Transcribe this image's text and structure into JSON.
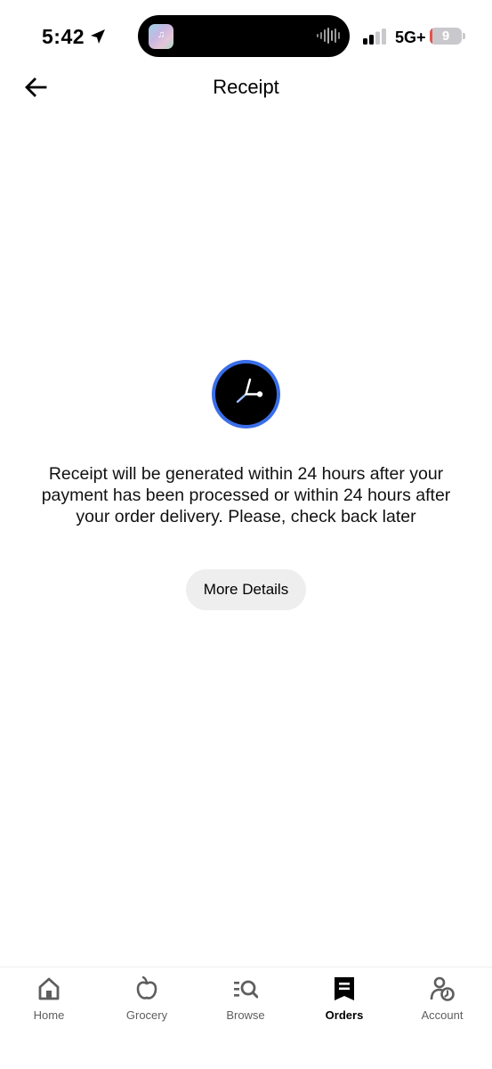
{
  "status_bar": {
    "time": "5:42",
    "network": "5G+",
    "battery_level": "9",
    "battery_fraction": 0.09,
    "icons": [
      "location-arrow-icon",
      "cellular-signal-icon",
      "battery-icon"
    ]
  },
  "header": {
    "title": "Receipt",
    "back_icon": "arrow-left-icon"
  },
  "main": {
    "status_icon": "clock-icon",
    "message": "Receipt will be generated within 24 hours after your payment has been processed or within 24 hours after your order delivery. Please, check back later",
    "more_details_label": "More Details"
  },
  "bottom_nav": {
    "items": [
      {
        "label": "Home",
        "icon": "home-icon",
        "active": false
      },
      {
        "label": "Grocery",
        "icon": "apple-icon",
        "active": false
      },
      {
        "label": "Browse",
        "icon": "browse-search-icon",
        "active": false
      },
      {
        "label": "Orders",
        "icon": "receipt-icon",
        "active": true
      },
      {
        "label": "Account",
        "icon": "account-icon",
        "active": false
      }
    ]
  },
  "colors": {
    "clock_ring": "#3a6ee8",
    "button_bg": "#eeeeee",
    "battery_low": "#e5534b"
  }
}
